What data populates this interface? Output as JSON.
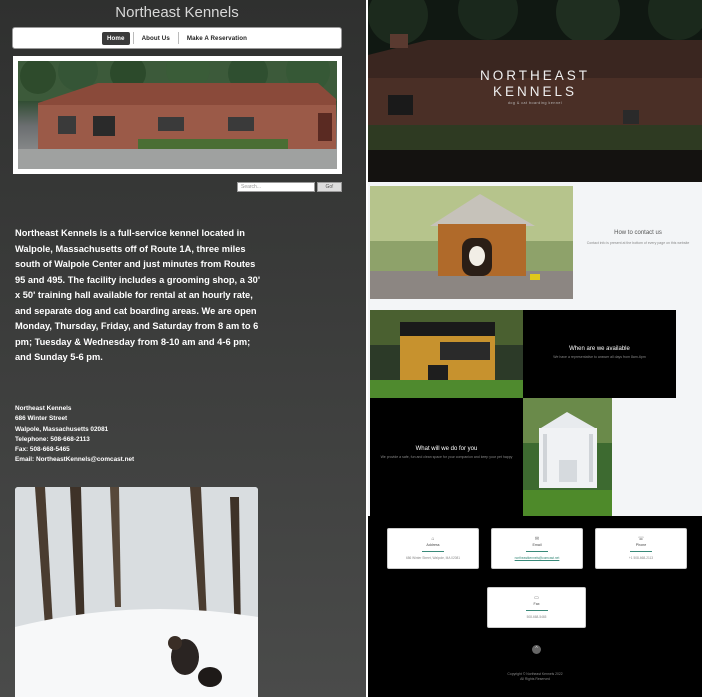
{
  "old_site": {
    "site_title": "Northeast Kennels",
    "nav": [
      {
        "label": "Home",
        "active": true
      },
      {
        "label": "About Us",
        "active": false
      },
      {
        "label": "Make A Reservation",
        "active": false
      }
    ],
    "search": {
      "placeholder": "Search...",
      "button": "Go!"
    },
    "intro": "Northeast Kennels is a full-service kennel located in Walpole, Massachusetts off of Route 1A, three miles south of Walpole Center and just minutes from Routes 95 and 495. The facility includes a grooming shop, a 30' x 50' training hall available for rental at an hourly rate, and separate dog and cat boarding areas. We are open Monday, Thursday, Friday, and Saturday from 8 am to 6 pm; Tuesday & Wednesday from 8-10 am and 4-6 pm; and Sunday 5-6 pm.",
    "contact": {
      "name": "Northeast Kennels",
      "street": "686 Winter Street",
      "city": "Walpole, Massachusetts 02081",
      "telephone": "Telephone: 508-668-2113",
      "fax": "Fax: 508-668-5465",
      "email": "Email: NortheastKennels@comcast.net"
    }
  },
  "new_site": {
    "hero_title_line1": "NORTHEAST",
    "hero_title_line2": "KENNELS",
    "hero_subtitle": "dog & cat boarding kennel",
    "tiles": {
      "contact": {
        "title": "How to contact us",
        "desc": "Contact info is present at the bottom of every page on this website"
      },
      "available": {
        "title": "When are we available",
        "desc": "We have a representative to answer all days from 8am-6pm"
      },
      "what_we_do": {
        "title": "What will we do for you",
        "desc": "We provide a safe, fun and clean space for your companion and keep your pet happy"
      }
    },
    "cards": [
      {
        "icon": "location-icon",
        "label": "Address",
        "value": "686 Winter Street, Walpole, MA 02081",
        "link": false
      },
      {
        "icon": "email-icon",
        "label": "Email",
        "value": "northeastkennels@comcast.net",
        "link": true
      },
      {
        "icon": "phone-icon",
        "label": "Phone",
        "value": "+1 508-668-2113",
        "link": false
      },
      {
        "icon": "fax-icon",
        "label": "Fax",
        "value": "508-668-5465",
        "link": false
      }
    ],
    "up_arrow": "^",
    "copyright_line1": "Copyright © Northeast Kennels 2022",
    "copyright_line2": "All Rights Reserved"
  }
}
